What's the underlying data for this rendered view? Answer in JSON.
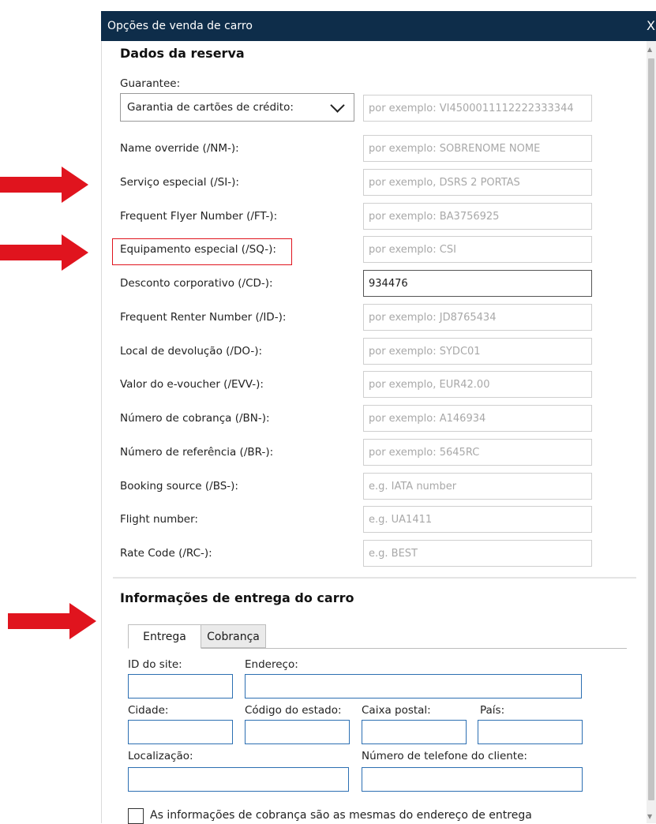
{
  "window": {
    "title": "Opções de venda de carro",
    "close": "X"
  },
  "reservation": {
    "heading": "Dados da reserva",
    "guarantee_label": "Guarantee:",
    "guarantee_value": "Garantia de cartões de crédito:",
    "guarantee_placeholder": "por exemplo: VI4500011112222333344",
    "fields": [
      {
        "label": "Name override (/NM-):",
        "placeholder": "por exemplo: SOBRENOME NOME",
        "value": ""
      },
      {
        "label": "Serviço especial (/SI-):",
        "placeholder": "por exemplo, DSRS 2 PORTAS",
        "value": ""
      },
      {
        "label": "Frequent Flyer Number (/FT-):",
        "placeholder": "por exemplo: BA3756925",
        "value": ""
      },
      {
        "label": "Equipamento especial (/SQ-):",
        "placeholder": "por exemplo: CSI",
        "value": ""
      },
      {
        "label": "Desconto corporativo (/CD-):",
        "placeholder": "",
        "value": "934476"
      },
      {
        "label": "Frequent Renter Number (/ID-):",
        "placeholder": "por exemplo: JD8765434",
        "value": ""
      },
      {
        "label": "Local de devolução (/DO-):",
        "placeholder": "por exemplo: SYDC01",
        "value": ""
      },
      {
        "label": "Valor do e-voucher (/EVV-):",
        "placeholder": "por exemplo, EUR42.00",
        "value": ""
      },
      {
        "label": "Número de cobrança (/BN-):",
        "placeholder": "por exemplo: A146934",
        "value": ""
      },
      {
        "label": "Número de referência (/BR-):",
        "placeholder": "por exemplo: 5645RC",
        "value": ""
      },
      {
        "label": "Booking source (/BS-):",
        "placeholder": "e.g. IATA number",
        "value": ""
      },
      {
        "label": "Flight number:",
        "placeholder": "e.g. UA1411",
        "value": ""
      },
      {
        "label": "Rate Code (/RC-):",
        "placeholder": "e.g. BEST",
        "value": ""
      }
    ]
  },
  "delivery": {
    "heading": "Informações de entrega do carro",
    "tabs": [
      "Entrega",
      "Cobrança"
    ],
    "site_id_label": "ID do site:",
    "address_label": "Endereço:",
    "city_label": "Cidade:",
    "state_label": "Código do estado:",
    "postal_label": "Caixa postal:",
    "country_label": "País:",
    "location_label": "Localização:",
    "phone_label": "Número de telefone do cliente:",
    "same_address_label": "As informações de cobrança são as mesmas do endereço de entrega"
  },
  "annotations": {
    "color": "#e0141e"
  }
}
